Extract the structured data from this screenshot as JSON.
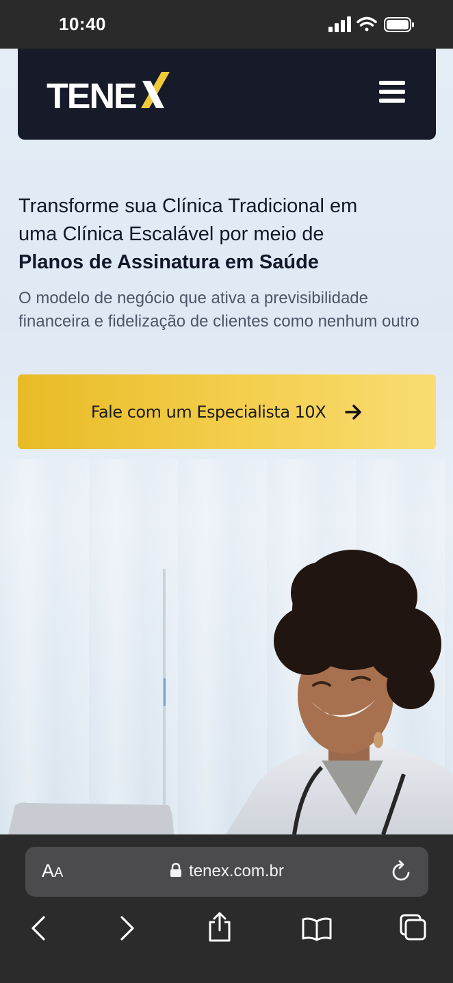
{
  "status_bar": {
    "time": "10:40",
    "icons": [
      "signal-icon",
      "wifi-icon",
      "battery-icon"
    ]
  },
  "site": {
    "logo_text": "TENEX",
    "menu_icon": "hamburger-menu-icon",
    "headline_lines": [
      "Transforme sua Clínica Tradicional em",
      "uma Clínica Escalável por meio de"
    ],
    "headline_strong": "Planos de Assinatura em Saúde",
    "subtext": "O modelo de negócio que ativa a previsibilidade financeira e fidelização de clientes como nenhum outro",
    "cta_label": "Fale com um Especialista 10X",
    "colors": {
      "navbar": "#171a28",
      "accent": "#f0c83c",
      "headline": "#121729",
      "subtext": "#4d5566"
    }
  },
  "browser": {
    "text_size_label_big": "A",
    "text_size_label_small": "A",
    "url": "tenex.com.br",
    "toolbar": [
      "back-icon",
      "forward-icon",
      "share-icon",
      "bookmarks-icon",
      "tabs-icon"
    ]
  }
}
